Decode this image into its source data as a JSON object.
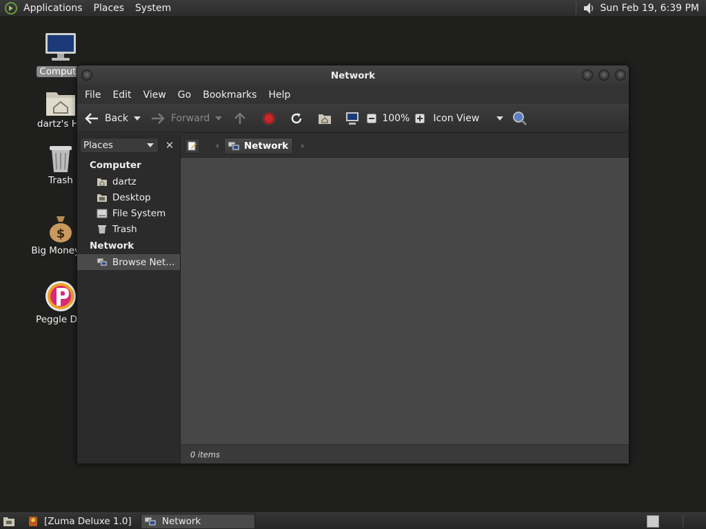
{
  "top_panel": {
    "menus": [
      "Applications",
      "Places",
      "System"
    ],
    "clock": "Sun Feb 19,  6:39 PM",
    "icons": [
      "gnome-foot-icon",
      "volume-icon"
    ]
  },
  "desktop": {
    "icons": [
      {
        "label": "Compute",
        "icon": "computer-icon",
        "selected": true
      },
      {
        "label": "dartz's Ho",
        "icon": "home-folder-icon"
      },
      {
        "label": "Trash",
        "icon": "trash-icon"
      },
      {
        "label": "Big Money D",
        "icon": "money-bag-icon"
      },
      {
        "label": "Peggle Del",
        "icon": "peggle-icon"
      }
    ]
  },
  "window": {
    "title": "Network",
    "menu": [
      "File",
      "Edit",
      "View",
      "Go",
      "Bookmarks",
      "Help"
    ],
    "toolbar": {
      "back": "Back",
      "forward": "Forward",
      "zoom": "100%",
      "view_mode": "Icon View"
    },
    "sidebar": {
      "selector": "Places",
      "sections": [
        {
          "heading": "Computer",
          "items": [
            {
              "label": "dartz",
              "icon": "home-icon"
            },
            {
              "label": "Desktop",
              "icon": "desktop-icon"
            },
            {
              "label": "File System",
              "icon": "drive-icon"
            },
            {
              "label": "Trash",
              "icon": "trash-icon"
            }
          ]
        },
        {
          "heading": "Network",
          "items": [
            {
              "label": "Browse Net…",
              "icon": "network-icon",
              "selected": true
            }
          ]
        }
      ]
    },
    "pathbar": {
      "current": "Network"
    },
    "status": "0 items"
  },
  "bottom_panel": {
    "tasks": [
      {
        "label": "[Zuma Deluxe 1.0]",
        "active": false
      },
      {
        "label": "Network",
        "active": true
      }
    ]
  }
}
